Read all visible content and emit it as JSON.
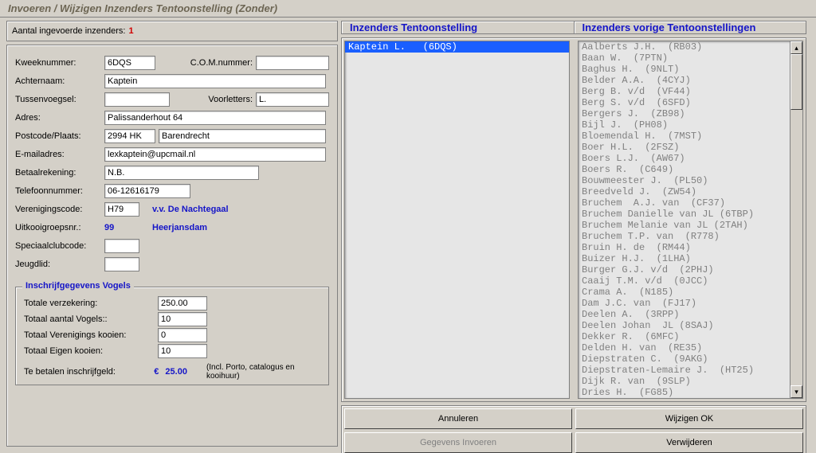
{
  "window": {
    "title": "Invoeren / Wijzigen Inzenders Tentoonstelling (Zonder)"
  },
  "counter": {
    "label": "Aantal ingevoerde inzenders:",
    "value": "1"
  },
  "form": {
    "kweeknummer": {
      "label": "Kweeknummer:",
      "value": "6DQS"
    },
    "comnummer": {
      "label": "C.O.M.nummer:",
      "value": ""
    },
    "achternaam": {
      "label": "Achternaam:",
      "value": "Kaptein"
    },
    "tussenvoegsel": {
      "label": "Tussenvoegsel:",
      "value": ""
    },
    "voorletters": {
      "label": "Voorletters:",
      "value": "L."
    },
    "adres": {
      "label": "Adres:",
      "value": "Palissanderhout 64"
    },
    "postcode": {
      "label": "Postcode/Plaats:",
      "value": "2994 HK"
    },
    "plaats": {
      "value": "Barendrecht"
    },
    "email": {
      "label": "E-mailadres:",
      "value": "lexkaptein@upcmail.nl"
    },
    "betaalrek": {
      "label": "Betaalrekening:",
      "value": "N.B."
    },
    "telefoon": {
      "label": "Telefoonnummer:",
      "value": "06-12616179"
    },
    "verenigingscode": {
      "label": "Verenigingscode:",
      "value": "H79",
      "naam": "v.v. De Nachtegaal"
    },
    "uitkooigroep": {
      "label": "Uitkooigroepsnr.:",
      "value": "99",
      "naam": "Heerjansdam"
    },
    "speciaalclub": {
      "label": "Speciaalclubcode:",
      "value": ""
    },
    "jeugdlid": {
      "label": "Jeugdlid:",
      "value": ""
    }
  },
  "inschrijf": {
    "legend": "Inschrijfgegevens Vogels",
    "verzekering": {
      "label": "Totale verzekering:",
      "value": "250.00"
    },
    "aantalvogels": {
      "label": "Totaal aantal Vogels::",
      "value": "10"
    },
    "verkooien": {
      "label": "Totaal Verenigings kooien:",
      "value": "0"
    },
    "eigenkooien": {
      "label": "Totaal Eigen kooien:",
      "value": "10"
    },
    "tebetalen": {
      "label": "Te betalen inschrijfgeld:",
      "euro": "€",
      "value": "25.00",
      "note": "(Incl. Porto, catalogus en kooihuur)"
    }
  },
  "headers": {
    "tentoon": "Inzenders Tentoonstelling",
    "vorige": "Inzenders vorige Tentoonstellingen"
  },
  "list_left": [
    "Kaptein L.   (6DQS)"
  ],
  "list_right": [
    "Aalberts J.H.  (RB03)",
    "Baan W.  (7PTN)",
    "Baghus H.  (9NLT)",
    "Belder A.A.  (4CYJ)",
    "Berg B. v/d  (VF44)",
    "Berg S. v/d  (6SFD)",
    "Bergers J.  (ZB98)",
    "Bijl J.  (PH08)",
    "Bloemendal H.  (7MST)",
    "Boer H.L.  (2FSZ)",
    "Boers L.J.  (AW67)",
    "Boers R.  (C649)",
    "Bouwmeester J.  (PL50)",
    "Breedveld J.  (ZW54)",
    "Bruchem  A.J. van  (CF37)",
    "Bruchem Danielle van JL (6TBP)",
    "Bruchem Melanie van JL (2TAH)",
    "Bruchem T.P. van  (R778)",
    "Bruin H. de  (RM44)",
    "Buizer H.J.  (1LHA)",
    "Burger G.J. v/d  (2PHJ)",
    "Caaij T.M. v/d  (0JCC)",
    "Crama A.  (N185)",
    "Dam J.C. van  (FJ17)",
    "Deelen A.  (3RPP)",
    "Deelen Johan  JL (8SAJ)",
    "Dekker R.  (6MFC)",
    "Delden H. van  (RE35)",
    "Diepstraten C.  (9AKG)",
    "Diepstraten-Lemaire J.  (HT25)",
    "Dijk R. van  (9SLP)",
    "Dries H.  (FG85)"
  ],
  "buttons": {
    "annuleren": "Annuleren",
    "wijzigen": "Wijzigen OK",
    "invoeren": "Gegevens Invoeren",
    "verwijderen": "Verwijderen"
  }
}
